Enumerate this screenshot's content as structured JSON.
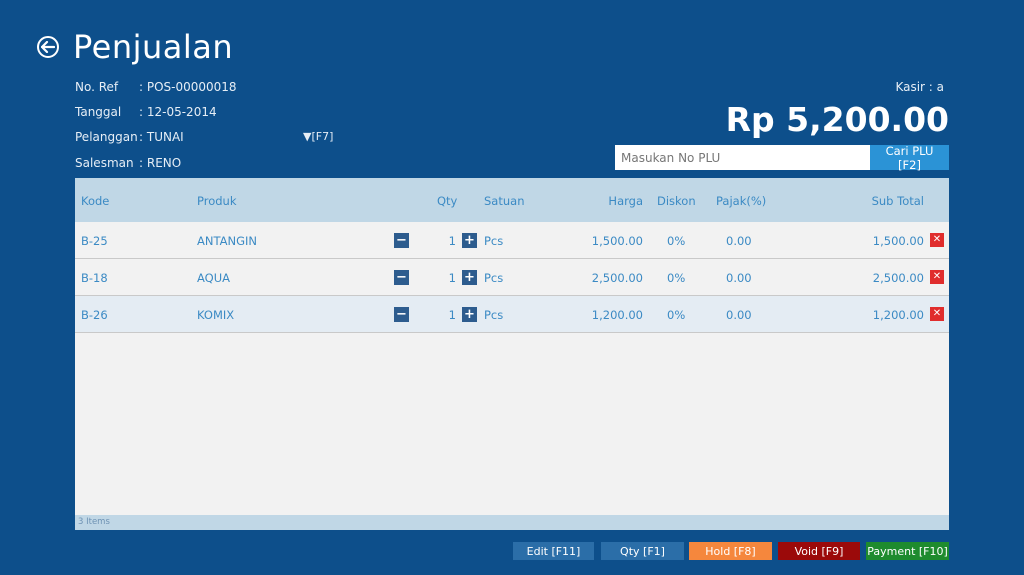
{
  "header": {
    "title": "Penjualan",
    "back_icon": "arrow-left-circle-icon"
  },
  "info": {
    "ref_label": "No. Ref",
    "ref_value": ": POS-00000018",
    "date_label": "Tanggal",
    "date_value": ": 12-05-2014",
    "customer_label": "Pelanggan",
    "customer_value": ": TUNAI",
    "customer_hotkey": "▼[F7]",
    "sales_label": "Salesman",
    "sales_value": ": RENO"
  },
  "kasir": "Kasir : a",
  "total": "Rp 5,200.00",
  "search": {
    "placeholder": "Masukan No PLU",
    "button_label": "Cari PLU [F2]"
  },
  "table": {
    "columns": {
      "kode": "Kode",
      "produk": "Produk",
      "qty": "Qty",
      "satuan": "Satuan",
      "harga": "Harga",
      "diskon": "Diskon",
      "pajak": "Pajak(%)",
      "subtotal": "Sub Total"
    },
    "rows": [
      {
        "kode": "B-25",
        "produk": "ANTANGIN",
        "qty": "1",
        "satuan": "Pcs",
        "harga": "1,500.00",
        "diskon": "0%",
        "pajak": "0.00",
        "subtotal": "1,500.00"
      },
      {
        "kode": "B-18",
        "produk": "AQUA",
        "qty": "1",
        "satuan": "Pcs",
        "harga": "2,500.00",
        "diskon": "0%",
        "pajak": "0.00",
        "subtotal": "2,500.00"
      },
      {
        "kode": "B-26",
        "produk": "KOMIX",
        "qty": "1",
        "satuan": "Pcs",
        "harga": "1,200.00",
        "diskon": "0%",
        "pajak": "0.00",
        "subtotal": "1,200.00"
      }
    ],
    "footer": "3 Items"
  },
  "buttons": {
    "edit": "Edit [F11]",
    "qty": "Qty [F1]",
    "hold": "Hold [F8]",
    "void": "Void [F9]",
    "payment": "Payment [F10]"
  },
  "colors": {
    "background": "#0d4f8b",
    "edit": "#2b6ea8",
    "qty": "#2b6ea8",
    "hold": "#f5873d",
    "void": "#9b0a0a",
    "payment": "#1e8b2e"
  }
}
